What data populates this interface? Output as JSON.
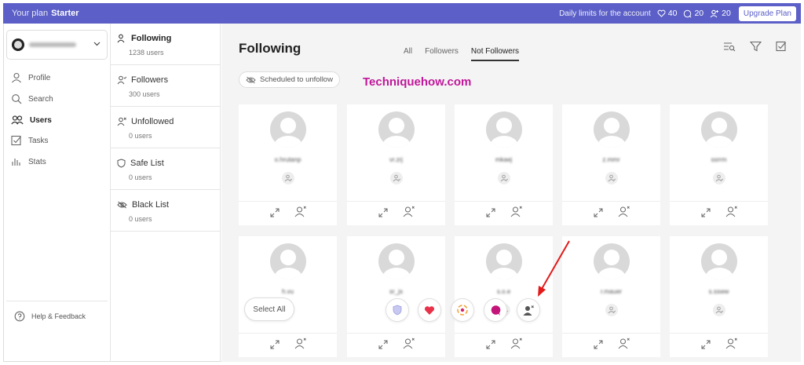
{
  "topbar": {
    "plan_label": "Your plan",
    "plan_name": "Starter",
    "limits_label": "Daily limits for the account",
    "likes": "40",
    "comments": "20",
    "follows": "20",
    "upgrade_label": "Upgrade Plan"
  },
  "account": {
    "name": "a.dprojects"
  },
  "nav": {
    "items": [
      {
        "label": "Profile",
        "icon": "user-icon"
      },
      {
        "label": "Search",
        "icon": "search-icon"
      },
      {
        "label": "Users",
        "icon": "users-icon",
        "active": true
      },
      {
        "label": "Tasks",
        "icon": "checkbox-icon"
      },
      {
        "label": "Stats",
        "icon": "bar-chart-icon"
      }
    ],
    "help_label": "Help & Feedback"
  },
  "subnav": {
    "items": [
      {
        "title": "Following",
        "count": "1238 users"
      },
      {
        "title": "Followers",
        "count": "300 users"
      },
      {
        "title": "Unfollowed",
        "count": "0 users"
      },
      {
        "title": "Safe List",
        "count": "0 users"
      },
      {
        "title": "Black List",
        "count": "0 users"
      }
    ]
  },
  "main": {
    "title": "Following",
    "tabs": [
      "All",
      "Followers",
      "Not Followers"
    ],
    "active_tab": "Not Followers",
    "scheduled_label": "Scheduled to unfollow",
    "watermark": "Techniquehow.com",
    "select_all_label": "Select All",
    "cards": [
      {
        "username": "o.hrutanp"
      },
      {
        "username": "vr.zrj"
      },
      {
        "username": "mkaej"
      },
      {
        "username": "z.mmr"
      },
      {
        "username": "ssrrm"
      },
      {
        "username": "h.vu"
      },
      {
        "username": "sr_js"
      },
      {
        "username": "s.o.e"
      },
      {
        "username": "r.mauer"
      },
      {
        "username": "s.ssww"
      }
    ]
  },
  "colors": {
    "brand": "#5b5fc7",
    "watermark": "#c0179a",
    "arrow": "#e21a1a",
    "heart": "#e8324a",
    "chat": "#c3147a"
  }
}
